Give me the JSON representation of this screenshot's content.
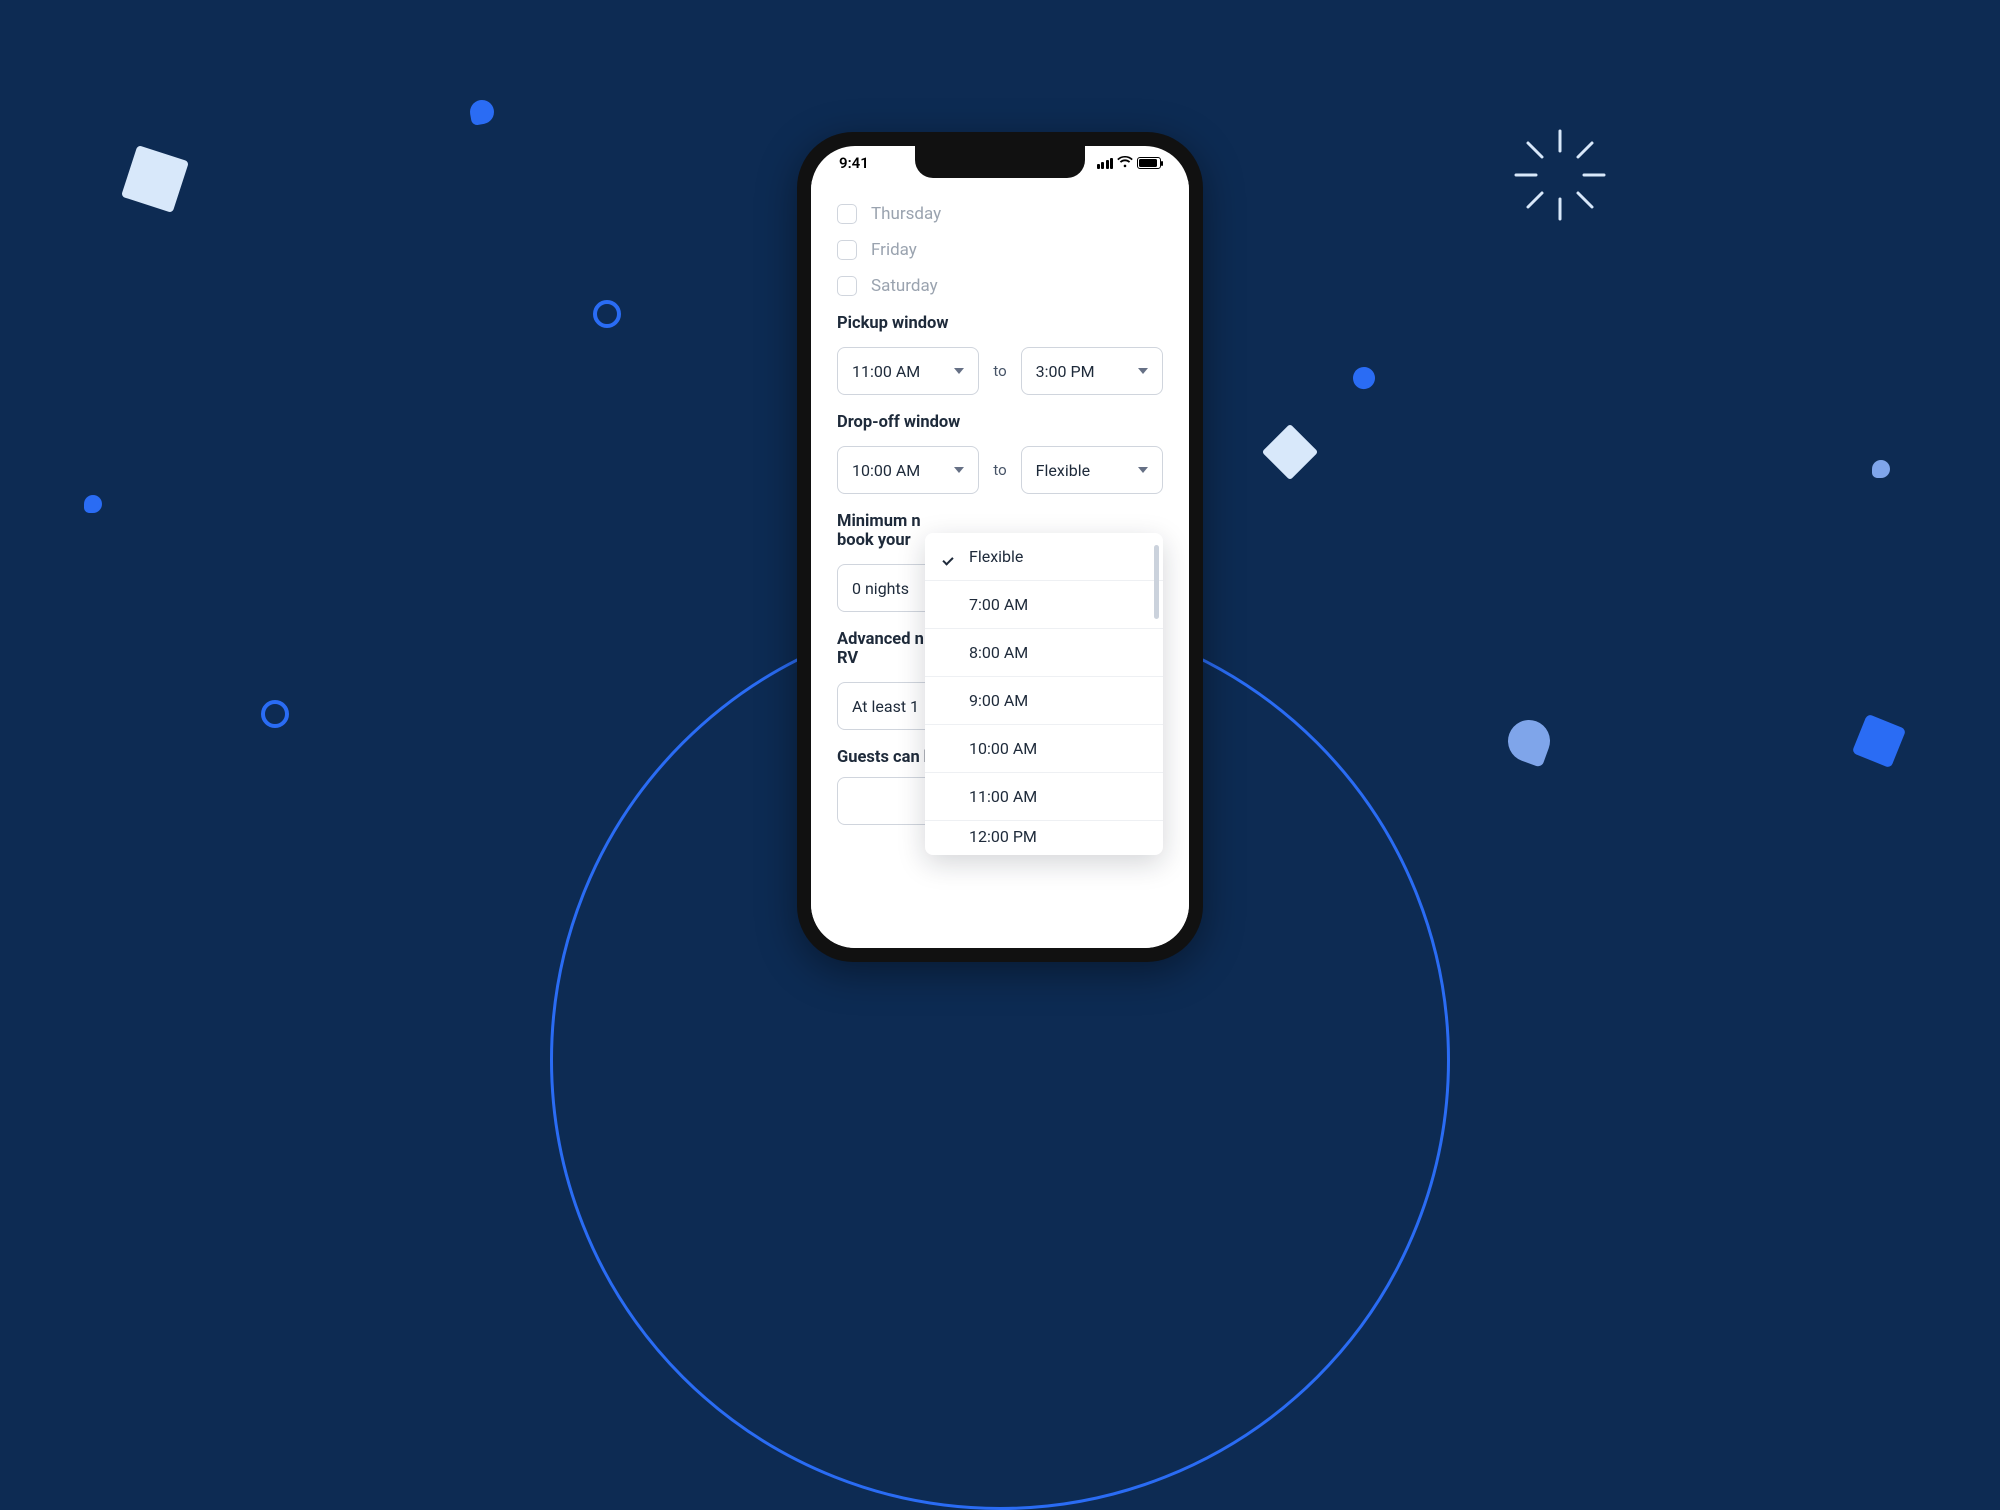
{
  "status": {
    "time": "9:41"
  },
  "days": [
    {
      "label": "Thursday"
    },
    {
      "label": "Friday"
    },
    {
      "label": "Saturday"
    }
  ],
  "pickup": {
    "label": "Pickup window",
    "from": "11:00 AM",
    "separator": "to",
    "to": "3:00 PM"
  },
  "dropoff": {
    "label": "Drop-off window",
    "from": "10:00 AM",
    "separator": "to",
    "to": "Flexible"
  },
  "min_nights": {
    "label_partial": "Minimum n",
    "label_partial_2": "book your",
    "value": "0 nights"
  },
  "advanced": {
    "label_partial": "Advanced n",
    "label_partial_2": "RV",
    "value_partial": "At least 1"
  },
  "guests_partial": "Guests can book your RV up to",
  "dropdown": {
    "options": [
      "Flexible",
      "7:00 AM",
      "8:00 AM",
      "9:00 AM",
      "10:00 AM",
      "11:00 AM",
      "12:00 PM"
    ]
  }
}
